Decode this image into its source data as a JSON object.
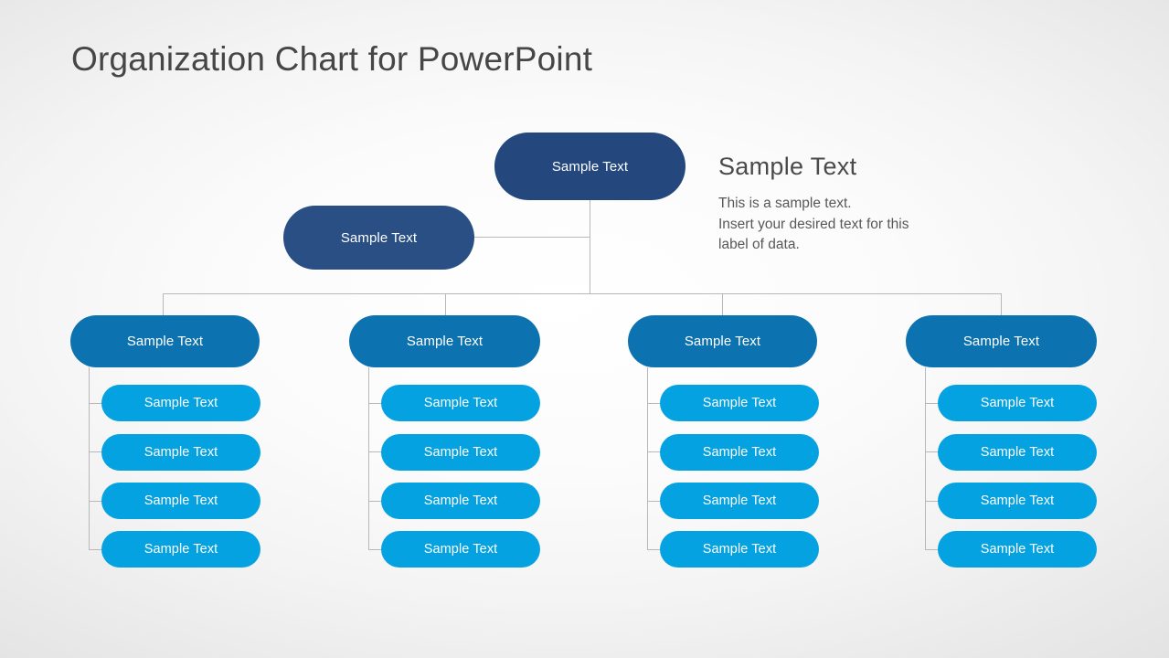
{
  "slide": {
    "title": "Organization Chart for PowerPoint"
  },
  "annotation": {
    "heading": "Sample  Text",
    "line1": "This is a sample text.",
    "line2": "Insert your desired text for this",
    "line3": "label of data."
  },
  "colors": {
    "level1": "#24487d",
    "level2": "#2a4f85",
    "level3": "#0d72b0",
    "level4": "#05a2e2",
    "connector": "#b8b8b8",
    "title_text": "#464646",
    "body_text": "#585858",
    "node_text": "#ffffff"
  },
  "chart_data": {
    "type": "diagram",
    "diagram_type": "organization-chart",
    "title": "Organization Chart for PowerPoint",
    "levels": 4,
    "root": {
      "label": "Sample Text",
      "level": 1
    },
    "assistant": {
      "label": "Sample Text",
      "level": 2
    },
    "branches": [
      {
        "label": "Sample Text",
        "level": 3,
        "children": [
          {
            "label": "Sample Text",
            "level": 4
          },
          {
            "label": "Sample Text",
            "level": 4
          },
          {
            "label": "Sample Text",
            "level": 4
          },
          {
            "label": "Sample Text",
            "level": 4
          }
        ]
      },
      {
        "label": "Sample Text",
        "level": 3,
        "children": [
          {
            "label": "Sample Text",
            "level": 4
          },
          {
            "label": "Sample Text",
            "level": 4
          },
          {
            "label": "Sample Text",
            "level": 4
          },
          {
            "label": "Sample Text",
            "level": 4
          }
        ]
      },
      {
        "label": "Sample Text",
        "level": 3,
        "children": [
          {
            "label": "Sample Text",
            "level": 4
          },
          {
            "label": "Sample Text",
            "level": 4
          },
          {
            "label": "Sample Text",
            "level": 4
          },
          {
            "label": "Sample Text",
            "level": 4
          }
        ]
      },
      {
        "label": "Sample Text",
        "level": 3,
        "children": [
          {
            "label": "Sample Text",
            "level": 4
          },
          {
            "label": "Sample Text",
            "level": 4
          },
          {
            "label": "Sample Text",
            "level": 4
          },
          {
            "label": "Sample Text",
            "level": 4
          }
        ]
      }
    ]
  }
}
